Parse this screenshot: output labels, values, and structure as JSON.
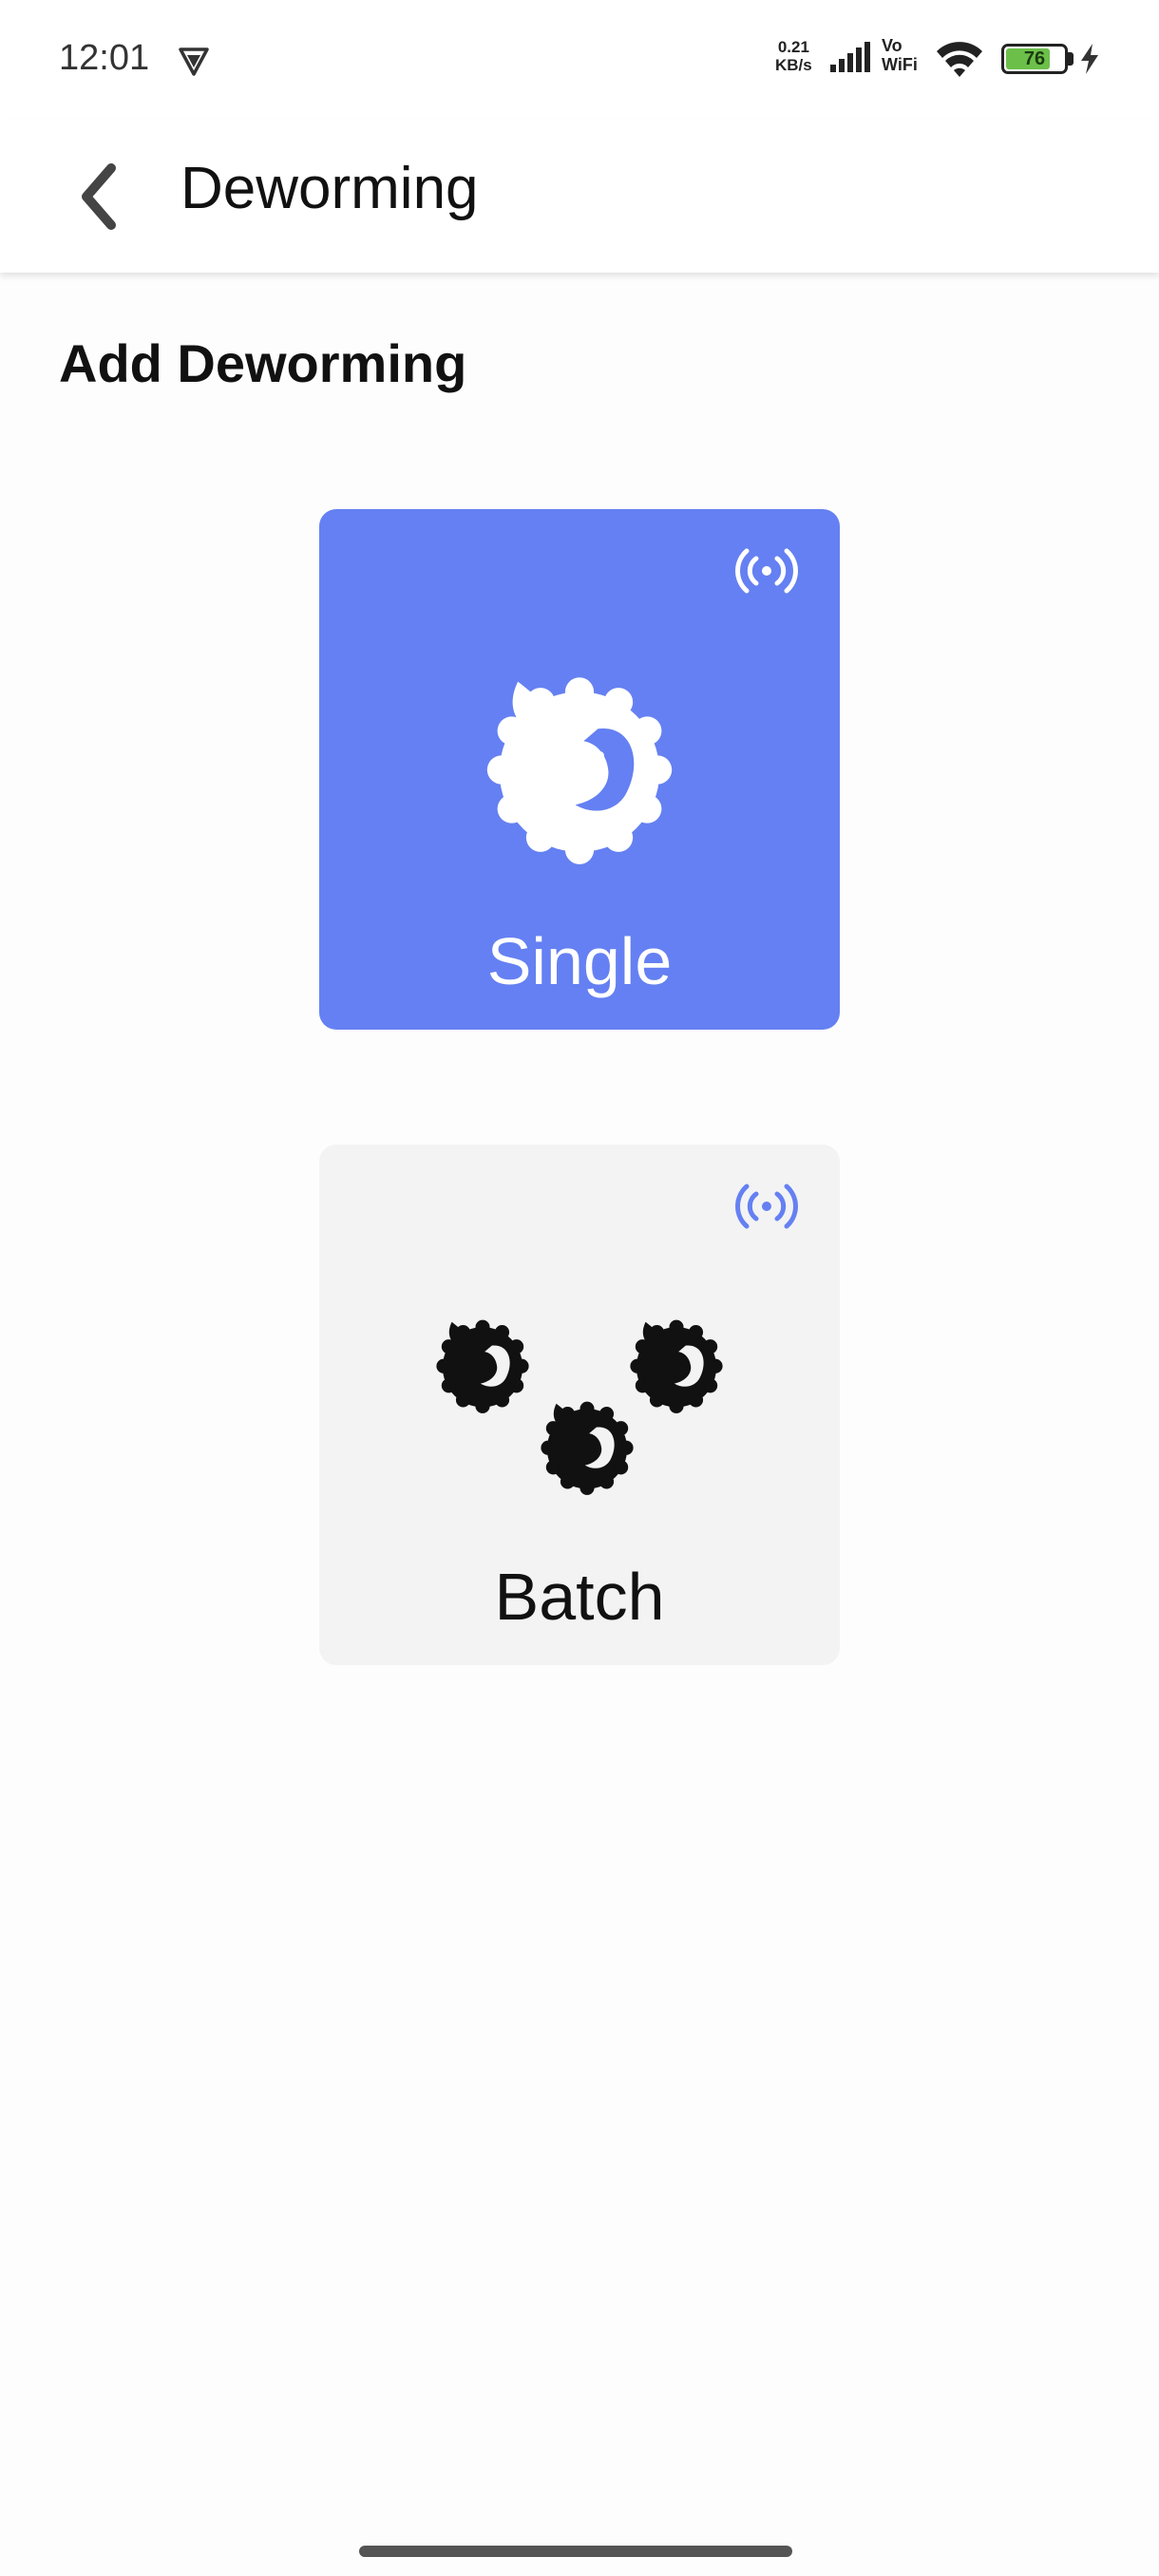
{
  "status_bar": {
    "time": "12:01",
    "net_speed_value": "0.21",
    "net_speed_unit": "KB/s",
    "vowifi_top": "Vo",
    "vowifi_bottom": "WiFi",
    "battery_level": "76",
    "battery_fraction": 0.76,
    "icons": [
      "vpn-icon",
      "signal-icon",
      "wifi-icon",
      "battery-icon",
      "charging-icon"
    ]
  },
  "app_bar": {
    "title": "Deworming",
    "back_icon": "chevron-left-icon"
  },
  "section": {
    "title": "Add Deworming"
  },
  "cards": {
    "single": {
      "label": "Single",
      "icon": "sheep-icon",
      "badge_icon": "rfid-icon"
    },
    "batch": {
      "label": "Batch",
      "icon": "sheep-group-icon",
      "badge_icon": "rfid-icon"
    }
  },
  "colors": {
    "accent": "#6580f2",
    "card_inactive": "#f3f3f4",
    "battery_green": "#6cc04a"
  }
}
